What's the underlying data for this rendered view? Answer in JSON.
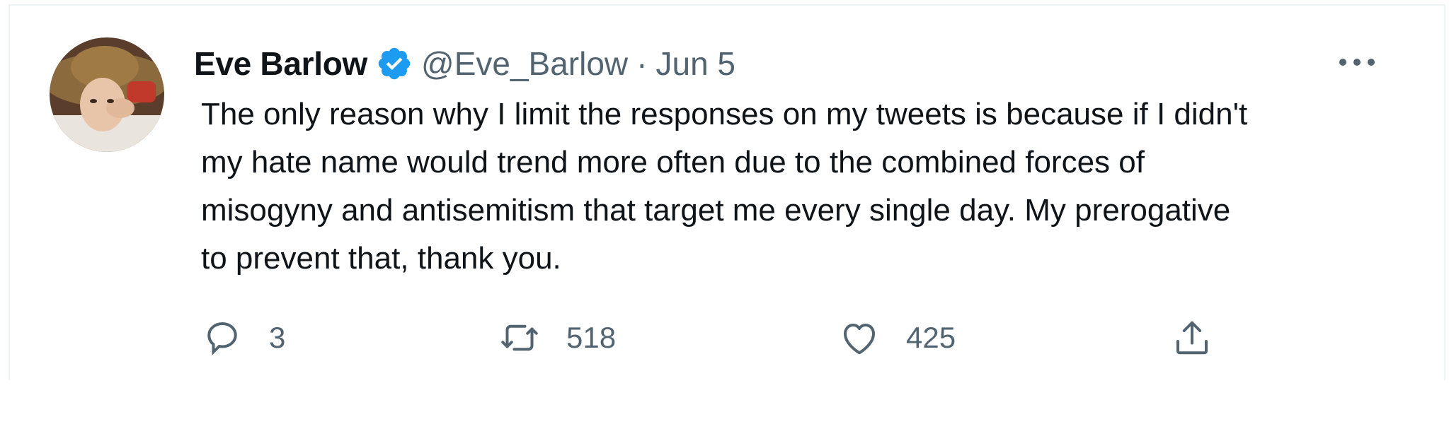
{
  "tweet": {
    "author": {
      "display_name": "Eve Barlow",
      "handle": "@Eve_Barlow",
      "verified": true
    },
    "separator": "·",
    "date": "Jun 5",
    "text": "The only reason why I limit the responses on my tweets is because if I didn't\nmy hate name would trend more often due to the combined forces of\nmisogyny and antisemitism that target me every single day. My prerogative\nto prevent that, thank you.",
    "actions": {
      "reply_count": "3",
      "retweet_count": "518",
      "like_count": "425"
    }
  },
  "icons": {
    "verified": "verified-badge-icon",
    "more": "more-horizontal-icon",
    "reply": "reply-bubble-icon",
    "retweet": "retweet-icon",
    "like": "heart-icon",
    "share": "share-upload-icon"
  },
  "colors": {
    "text_primary": "#0f1419",
    "text_secondary": "#536471",
    "verified_blue": "#1d9bf0",
    "border": "#eff3f4"
  }
}
